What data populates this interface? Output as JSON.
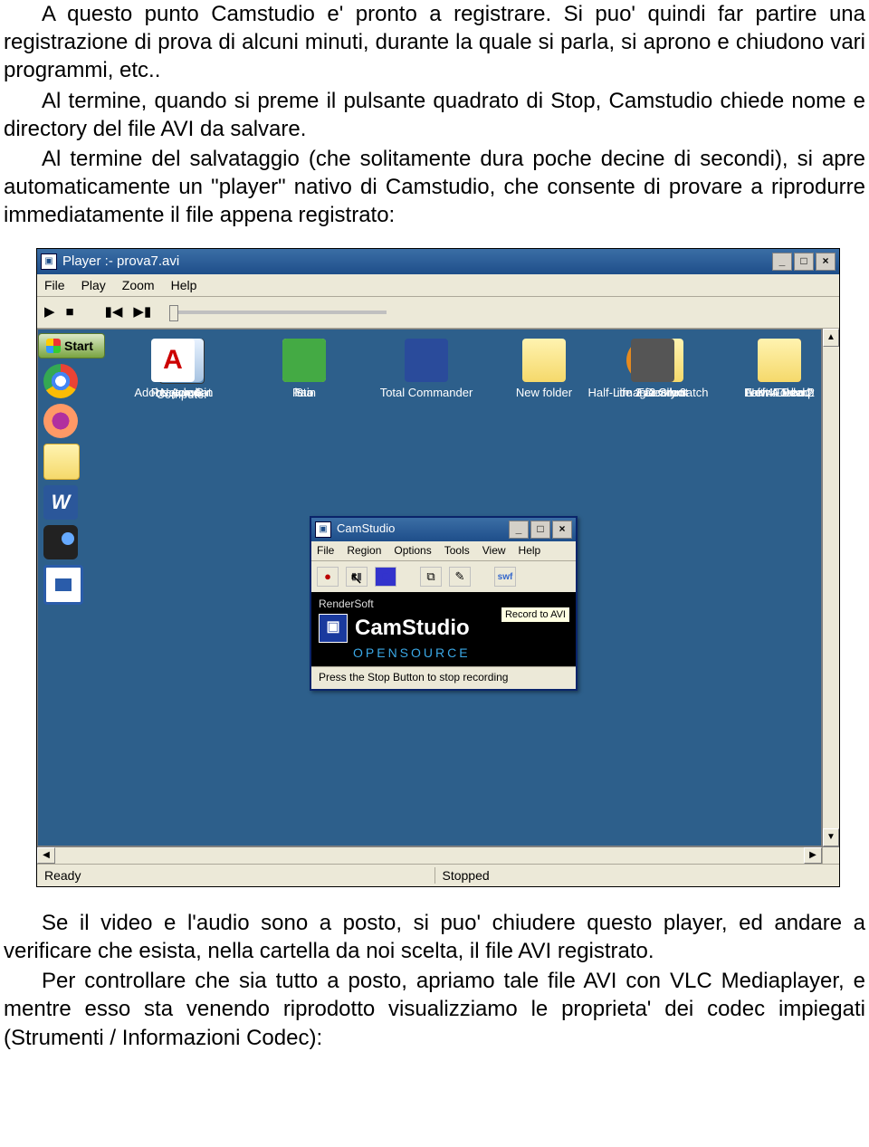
{
  "paragraphs": {
    "p1": "A questo punto Camstudio e' pronto a registrare. Si puo' quindi far partire una registrazione di prova di alcuni minuti, durante la quale si parla, si aprono e chiudono vari programmi, etc..",
    "p2": "Al termine, quando si preme il pulsante quadrato di Stop, Camstudio chiede nome e directory del file AVI da salvare.",
    "p3": "Al termine del salvataggio (che solitamente dura poche decine di secondi), si apre automaticamente un \"player\" nativo di Camstudio, che consente di provare a riprodurre immediatamente il file appena registrato:",
    "p4": "Se il video e l'audio sono a posto, si puo' chiudere questo player, ed andare a verificare che esista, nella cartella da noi scelta, il file AVI registrato.",
    "p5": "Per controllare che sia tutto a posto, apriamo tale file AVI con VLC Mediaplayer, e mentre esso sta venendo riprodotto visualizziamo le proprieta' dei codec impiegati (Strumenti / Informazioni Codec):"
  },
  "player": {
    "title": "Player :- prova7.avi",
    "menu": {
      "file": "File",
      "play": "Play",
      "zoom": "Zoom",
      "help": "Help"
    },
    "status_left": "Ready",
    "status_right": "Stopped"
  },
  "desktop": {
    "start": "Start",
    "icons": {
      "computer": "Computer",
      "total": "Total Commander",
      "newfolder": "New folder",
      "farcry": "Far Cry 3",
      "farina": "Farina 1.bmp",
      "network": "Network",
      "pain": "Pain",
      "giacomo": "giacomo",
      "l4d2": "Left 4 Dead 2",
      "recycle": "Recycle Bin",
      "leo": "le o",
      "hl2": "Half-Life 2 Deathmatch",
      "l4d": "Left 4 Dead",
      "adobe": "Adobe Acrobat",
      "sta": "Sta",
      "itman": "itman 2 Silent",
      "newfolder2": "New Folder2"
    }
  },
  "camstudio": {
    "title": "CamStudio",
    "menu": {
      "file": "File",
      "region": "Region",
      "options": "Options",
      "tools": "Tools",
      "view": "View",
      "help": "Help"
    },
    "tooltip": "Record to AVI",
    "rendersoft": "RenderSoft",
    "name": "CamStudio",
    "opensource": "OPENSOURCE",
    "status": "Press the Stop Button to stop recording"
  }
}
